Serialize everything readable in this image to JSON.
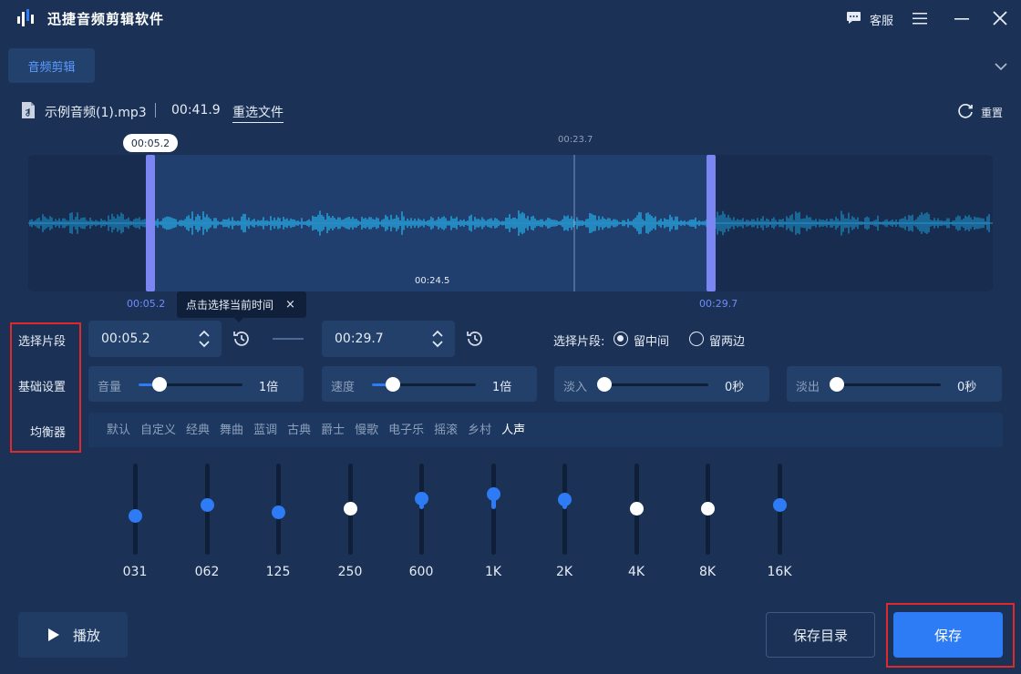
{
  "app": {
    "title": "迅捷音频剪辑软件",
    "support_label": "客服",
    "icons": {
      "logo": "app-logo-icon",
      "support": "chat-bubble-icon",
      "menu": "hamburger-menu-icon",
      "minimize": "minimize-icon",
      "close": "close-icon"
    }
  },
  "tabs": [
    {
      "label": "音频剪辑",
      "active": true
    }
  ],
  "file": {
    "name": "示例音频(1).mp3",
    "duration": "00:41.9",
    "reselect_label": "重选文件",
    "reset_label": "重置"
  },
  "waveform": {
    "selection_start_tooltip": "00:05.2",
    "playhead_time": "00:23.7",
    "selection_length": "00:24.5",
    "start_label": "00:05.2",
    "end_label": "00:29.7",
    "selection_start_fraction": 0.124,
    "selection_end_fraction": 0.709,
    "playhead_fraction": 0.566,
    "colors": {
      "wave": "#28b8f2",
      "selection": "#203f6e",
      "handle": "#7b86f2"
    }
  },
  "hint": {
    "text": "点击选择当前时间",
    "close": "×"
  },
  "sections": {
    "clip": "选择片段",
    "basic": "基础设置",
    "eq": "均衡器"
  },
  "clip": {
    "start": "00:05.2",
    "end": "00:29.7",
    "mode_label": "选择片段:",
    "options": [
      {
        "label": "留中间",
        "selected": true
      },
      {
        "label": "留两边",
        "selected": false
      }
    ]
  },
  "basic": {
    "volume": {
      "label": "音量",
      "value": "1倍",
      "level": 0.2
    },
    "speed": {
      "label": "速度",
      "value": "1倍",
      "level": 0.2
    },
    "fade_in": {
      "label": "淡入",
      "value": "0秒",
      "level": 0.0
    },
    "fade_out": {
      "label": "淡出",
      "value": "0秒",
      "level": 0.0
    }
  },
  "eq": {
    "presets": [
      "默认",
      "自定义",
      "经典",
      "舞曲",
      "蓝调",
      "古典",
      "爵士",
      "慢歌",
      "电子乐",
      "摇滚",
      "乡村",
      "人声"
    ],
    "active_preset": "人声",
    "bands": [
      {
        "label": "031",
        "level": 0.43
      },
      {
        "label": "062",
        "level": 0.55
      },
      {
        "label": "125",
        "level": 0.47
      },
      {
        "label": "250",
        "level": 0.51
      },
      {
        "label": "600",
        "level": 0.62
      },
      {
        "label": "1K",
        "level": 0.67
      },
      {
        "label": "2K",
        "level": 0.61
      },
      {
        "label": "4K",
        "level": 0.51
      },
      {
        "label": "8K",
        "level": 0.51
      },
      {
        "label": "16K",
        "level": 0.55
      }
    ]
  },
  "footer": {
    "play": "播放",
    "save_dir": "保存目录",
    "save": "保存"
  },
  "colors": {
    "accent": "#2d7bf5",
    "bg": "#1b3256",
    "highlight": "#e02a2a"
  }
}
